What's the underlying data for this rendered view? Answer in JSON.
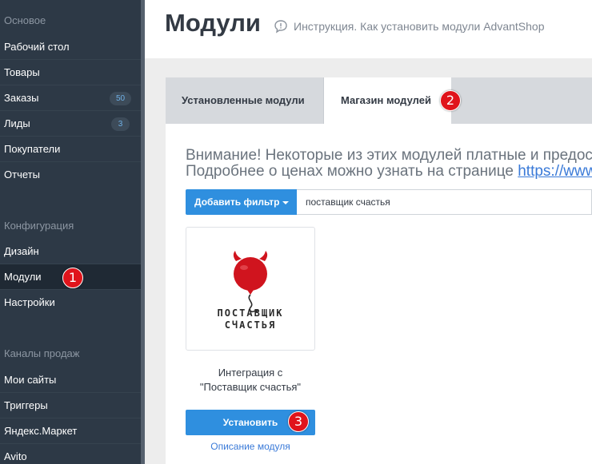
{
  "sidebar": {
    "sections": [
      {
        "title": "Основое"
      },
      {
        "title": "Конфигурация"
      },
      {
        "title": "Каналы продаж"
      }
    ],
    "items": [
      {
        "label": "Рабочий стол"
      },
      {
        "label": "Товары"
      },
      {
        "label": "Заказы",
        "badge": "50"
      },
      {
        "label": "Лиды",
        "badge": "3"
      },
      {
        "label": "Покупатели"
      },
      {
        "label": "Отчеты"
      },
      {
        "label": "Дизайн"
      },
      {
        "label": "Модули",
        "active": true
      },
      {
        "label": "Настройки"
      },
      {
        "label": "Мои сайты"
      },
      {
        "label": "Триггеры"
      },
      {
        "label": "Яндекс.Маркет"
      },
      {
        "label": "Avito"
      }
    ]
  },
  "header": {
    "title": "Модули",
    "help_link": "Инструкция. Как установить модули AdvantShop"
  },
  "tabs": [
    {
      "label": "Установленные модули",
      "active": false
    },
    {
      "label": "Магазин модулей",
      "active": true
    }
  ],
  "notice": {
    "line1": "Внимание! Некоторые из этих модулей платные и предос",
    "line2_prefix": "Подробнее о ценах можно узнать на странице ",
    "line2_link": "https://www"
  },
  "filter": {
    "button_label": "Добавить фильтр",
    "value": "поставщик счастья"
  },
  "module": {
    "logo_line1": "ПОСТАВЩИК",
    "logo_line2": "СЧАСТЬЯ",
    "name_line1": "Интеграция с",
    "name_line2": "\"Поставщик счастья\"",
    "install_label": "Установить",
    "description_link": "Описание модуля"
  },
  "markers": [
    "1",
    "2",
    "3"
  ],
  "colors": {
    "sidebar_bg": "#2d3946",
    "accent_blue": "#2f8fdf",
    "marker_red": "#e0141b",
    "logo_red": "#d0141e"
  }
}
